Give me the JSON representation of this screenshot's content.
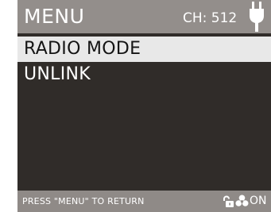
{
  "header": {
    "title": "MENU",
    "channel": "CH: 512",
    "power_icon": "plug-icon"
  },
  "menu": {
    "items": [
      {
        "label": "RADIO MODE",
        "selected": true
      },
      {
        "label": "UNLINK",
        "selected": false
      }
    ]
  },
  "footer": {
    "hint": "PRESS \"MENU\" TO RETURN",
    "lock_icon": "unlock-icon",
    "fan_icon": "fan-icon",
    "fan_status": "ON"
  },
  "colors": {
    "panel_bg": "#302c29",
    "header_bg": "#938e8b",
    "selected_bg": "#e8e8e8",
    "text": "#ffffff"
  }
}
